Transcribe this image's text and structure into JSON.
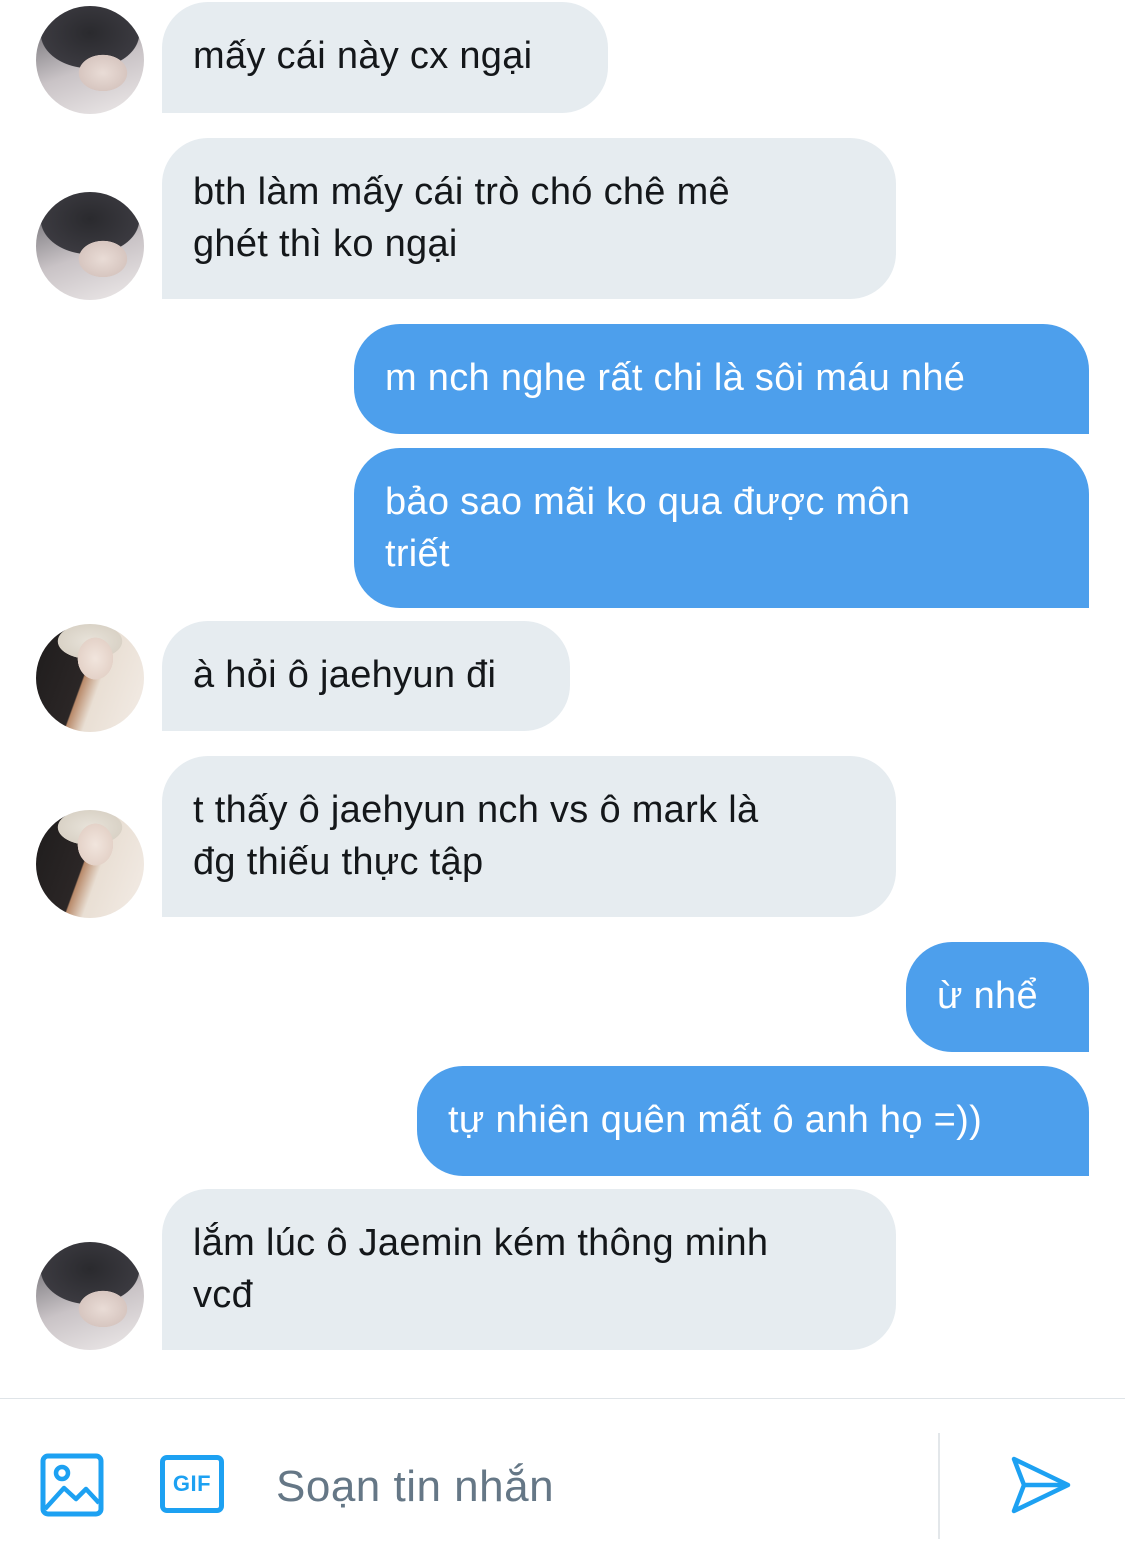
{
  "messages": [
    {
      "side": "in",
      "avatar": "avatar-a",
      "text": "mấy cái này cx ngại"
    },
    {
      "side": "in",
      "avatar": "avatar-a",
      "text": "bth làm mấy cái trò chó chê mê\nghét thì ko ngại"
    },
    {
      "side": "out",
      "text": "m nch nghe rất chi là sôi máu nhé"
    },
    {
      "side": "out",
      "text": "bảo sao mãi ko qua được môn\ntriết"
    },
    {
      "side": "in",
      "avatar": "avatar-b",
      "text": "à hỏi ô jaehyun đi"
    },
    {
      "side": "in",
      "avatar": "avatar-b",
      "text": "t thấy ô jaehyun nch vs ô mark là\nđg thiếu thực tập"
    },
    {
      "side": "out",
      "text": "ừ nhể"
    },
    {
      "side": "out",
      "text": "tự nhiên quên mất ô anh họ =))"
    },
    {
      "side": "in",
      "avatar": "avatar-a",
      "text": "lắm lúc ô Jaemin kém thông minh\nvcđ"
    }
  ],
  "composer": {
    "placeholder": "Soạn tin nhắn",
    "gif_label": "GIF",
    "media_icon": "image-icon",
    "send_icon": "send-icon"
  },
  "colors": {
    "incoming_bubble": "#e6ecf0",
    "outgoing_bubble": "#4d9fec",
    "accent": "#1da1f2"
  }
}
